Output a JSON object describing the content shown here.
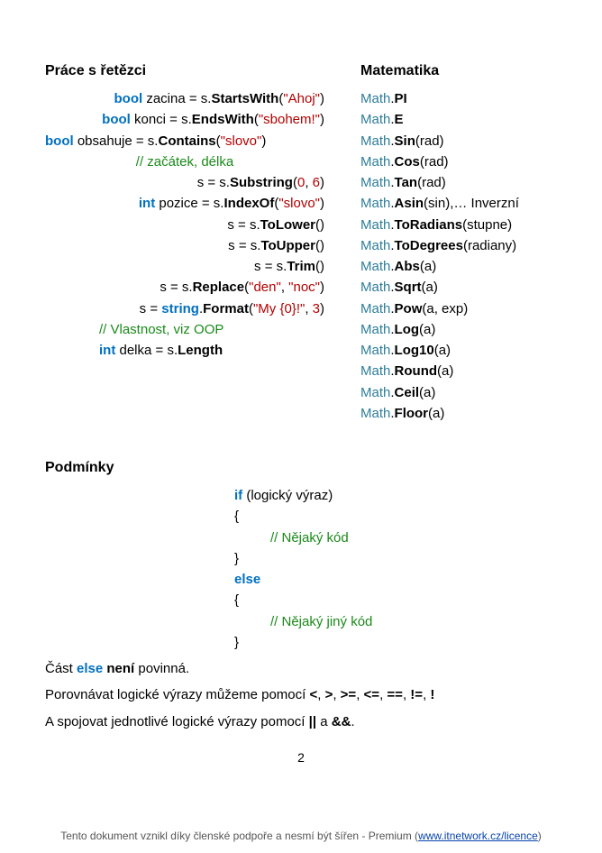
{
  "headings": {
    "h1": "Práce s řetězci",
    "h2": "Matematika",
    "h3": "Podmínky"
  },
  "left": {
    "l1": {
      "kw": "bool",
      "v": " zacina = s.",
      "m": "StartsWith",
      "a": "(",
      "s": "\"Ahoj\"",
      "e": ")"
    },
    "l2": {
      "kw": "bool",
      "v": " konci = s.",
      "m": "EndsWith",
      "a": "(",
      "s": "\"sbohem!\"",
      "e": ")"
    },
    "l3": {
      "kw": "bool",
      "v": " obsahuje = s.",
      "m": "Contains",
      "a": "(",
      "s": "\"slovo\"",
      "e": ")"
    },
    "l4": {
      "c": "// začátek, délka"
    },
    "l5": {
      "v": "s = s.",
      "m": "Substring",
      "a": "(",
      "n1": "0",
      "comma": ", ",
      "n2": "6",
      "e": ")"
    },
    "l6": {
      "kw": "int",
      "v": " pozice = s.",
      "m": "IndexOf",
      "a": "(",
      "s": "\"slovo\"",
      "e": ")"
    },
    "l7": {
      "v": "s = s.",
      "m": "ToLower",
      "e": "()"
    },
    "l8": {
      "v": "s = s.",
      "m": "ToUpper",
      "e": "()"
    },
    "l9": {
      "v": "s = s.",
      "m": "Trim",
      "e": "()"
    },
    "l10": {
      "v": "s =  s.",
      "m": "Replace",
      "a": "(",
      "s1": "\"den\"",
      "comma": ", ",
      "s2": "\"noc\"",
      "e": ")"
    },
    "l11": {
      "v": "s = ",
      "kw": "string",
      "dot": ".",
      "m": "Format",
      "a": "(",
      "s": "\"My {0}!\"",
      "comma": ", ",
      "n": "3",
      "e": ")"
    },
    "l12": {
      "c": "// Vlastnost, viz OOP"
    },
    "l13": {
      "kw": "int",
      "v": " delka = s.",
      "m": "Length"
    }
  },
  "right": {
    "r1": {
      "c": "Math",
      "d": ".",
      "m": "PI"
    },
    "r2": {
      "c": "Math",
      "d": ".",
      "m": "E"
    },
    "r3": {
      "c": "Math",
      "d": ".",
      "m": "Sin",
      "a": "(rad)"
    },
    "r4": {
      "c": "Math",
      "d": ".",
      "m": "Cos",
      "a": "(rad)"
    },
    "r5": {
      "c": "Math",
      "d": ".",
      "m": "Tan",
      "a": "(rad)"
    },
    "r6": {
      "c": "Math",
      "d": ".",
      "m": "Asin",
      "a": "(sin),… Inverzní"
    },
    "r7": {
      "c": "Math",
      "d": ".",
      "m": "ToRadians",
      "a": "(stupne)"
    },
    "r8": {
      "c": "Math",
      "d": ".",
      "m": "ToDegrees",
      "a": "(radiany)"
    },
    "r9": {
      "c": "Math",
      "d": ".",
      "m": "Abs",
      "a": "(a)"
    },
    "r10": {
      "c": "Math",
      "d": ".",
      "m": "Sqrt",
      "a": "(a)"
    },
    "r11": {
      "c": "Math",
      "d": ".",
      "m": "Pow",
      "a": "(a, exp)"
    },
    "r12": {
      "c": "Math",
      "d": ".",
      "m": "Log",
      "a": "(a)"
    },
    "r13": {
      "c": "Math",
      "d": ".",
      "m": "Log10",
      "a": "(a)"
    },
    "r14": {
      "c": "Math",
      "d": ".",
      "m": "Round",
      "a": "(a)"
    },
    "r15": {
      "c": "Math",
      "d": ".",
      "m": "Ceil",
      "a": "(a)"
    },
    "r16": {
      "c": "Math",
      "d": ".",
      "m": "Floor",
      "a": "(a)"
    }
  },
  "cond": {
    "c1": {
      "kw": "if",
      "t": " (logický výraz)"
    },
    "c2": {
      "t": "{"
    },
    "c3": {
      "c": "// Nějaký kód"
    },
    "c4": {
      "t": "}"
    },
    "c5": {
      "kw": "else"
    },
    "c6": {
      "t": "{"
    },
    "c7": {
      "c": "// Nějaký jiný kód"
    },
    "c8": {
      "t": "}"
    }
  },
  "para": {
    "p1a": "Část ",
    "p1kw": "else",
    "p1b": " ",
    "p1bold": "není",
    "p1c": " povinná.",
    "p2a": "Porovnávat logické výrazy můžeme pomocí ",
    "p2ops": "<",
    "p2s1": ", ",
    "p2op2": ">",
    "p2s2": ", ",
    "p2op3": ">=",
    "p2s3": ", ",
    "p2op4": "<=",
    "p2s4": ", ",
    "p2op5": "==",
    "p2s5": ", ",
    "p2op6": "!=",
    "p2s6": ", ",
    "p2op7": "!",
    "p3a": "A spojovat jednotlivé logické výrazy pomocí ",
    "p3op1": "||",
    "p3b": " a ",
    "p3op2": "&&",
    "p3c": "."
  },
  "footer": {
    "page": "2",
    "text": "Tento dokument vznikl díky členské podpoře a nesmí být šířen - Premium (",
    "link": "www.itnetwork.cz/licence",
    "close": ")"
  }
}
